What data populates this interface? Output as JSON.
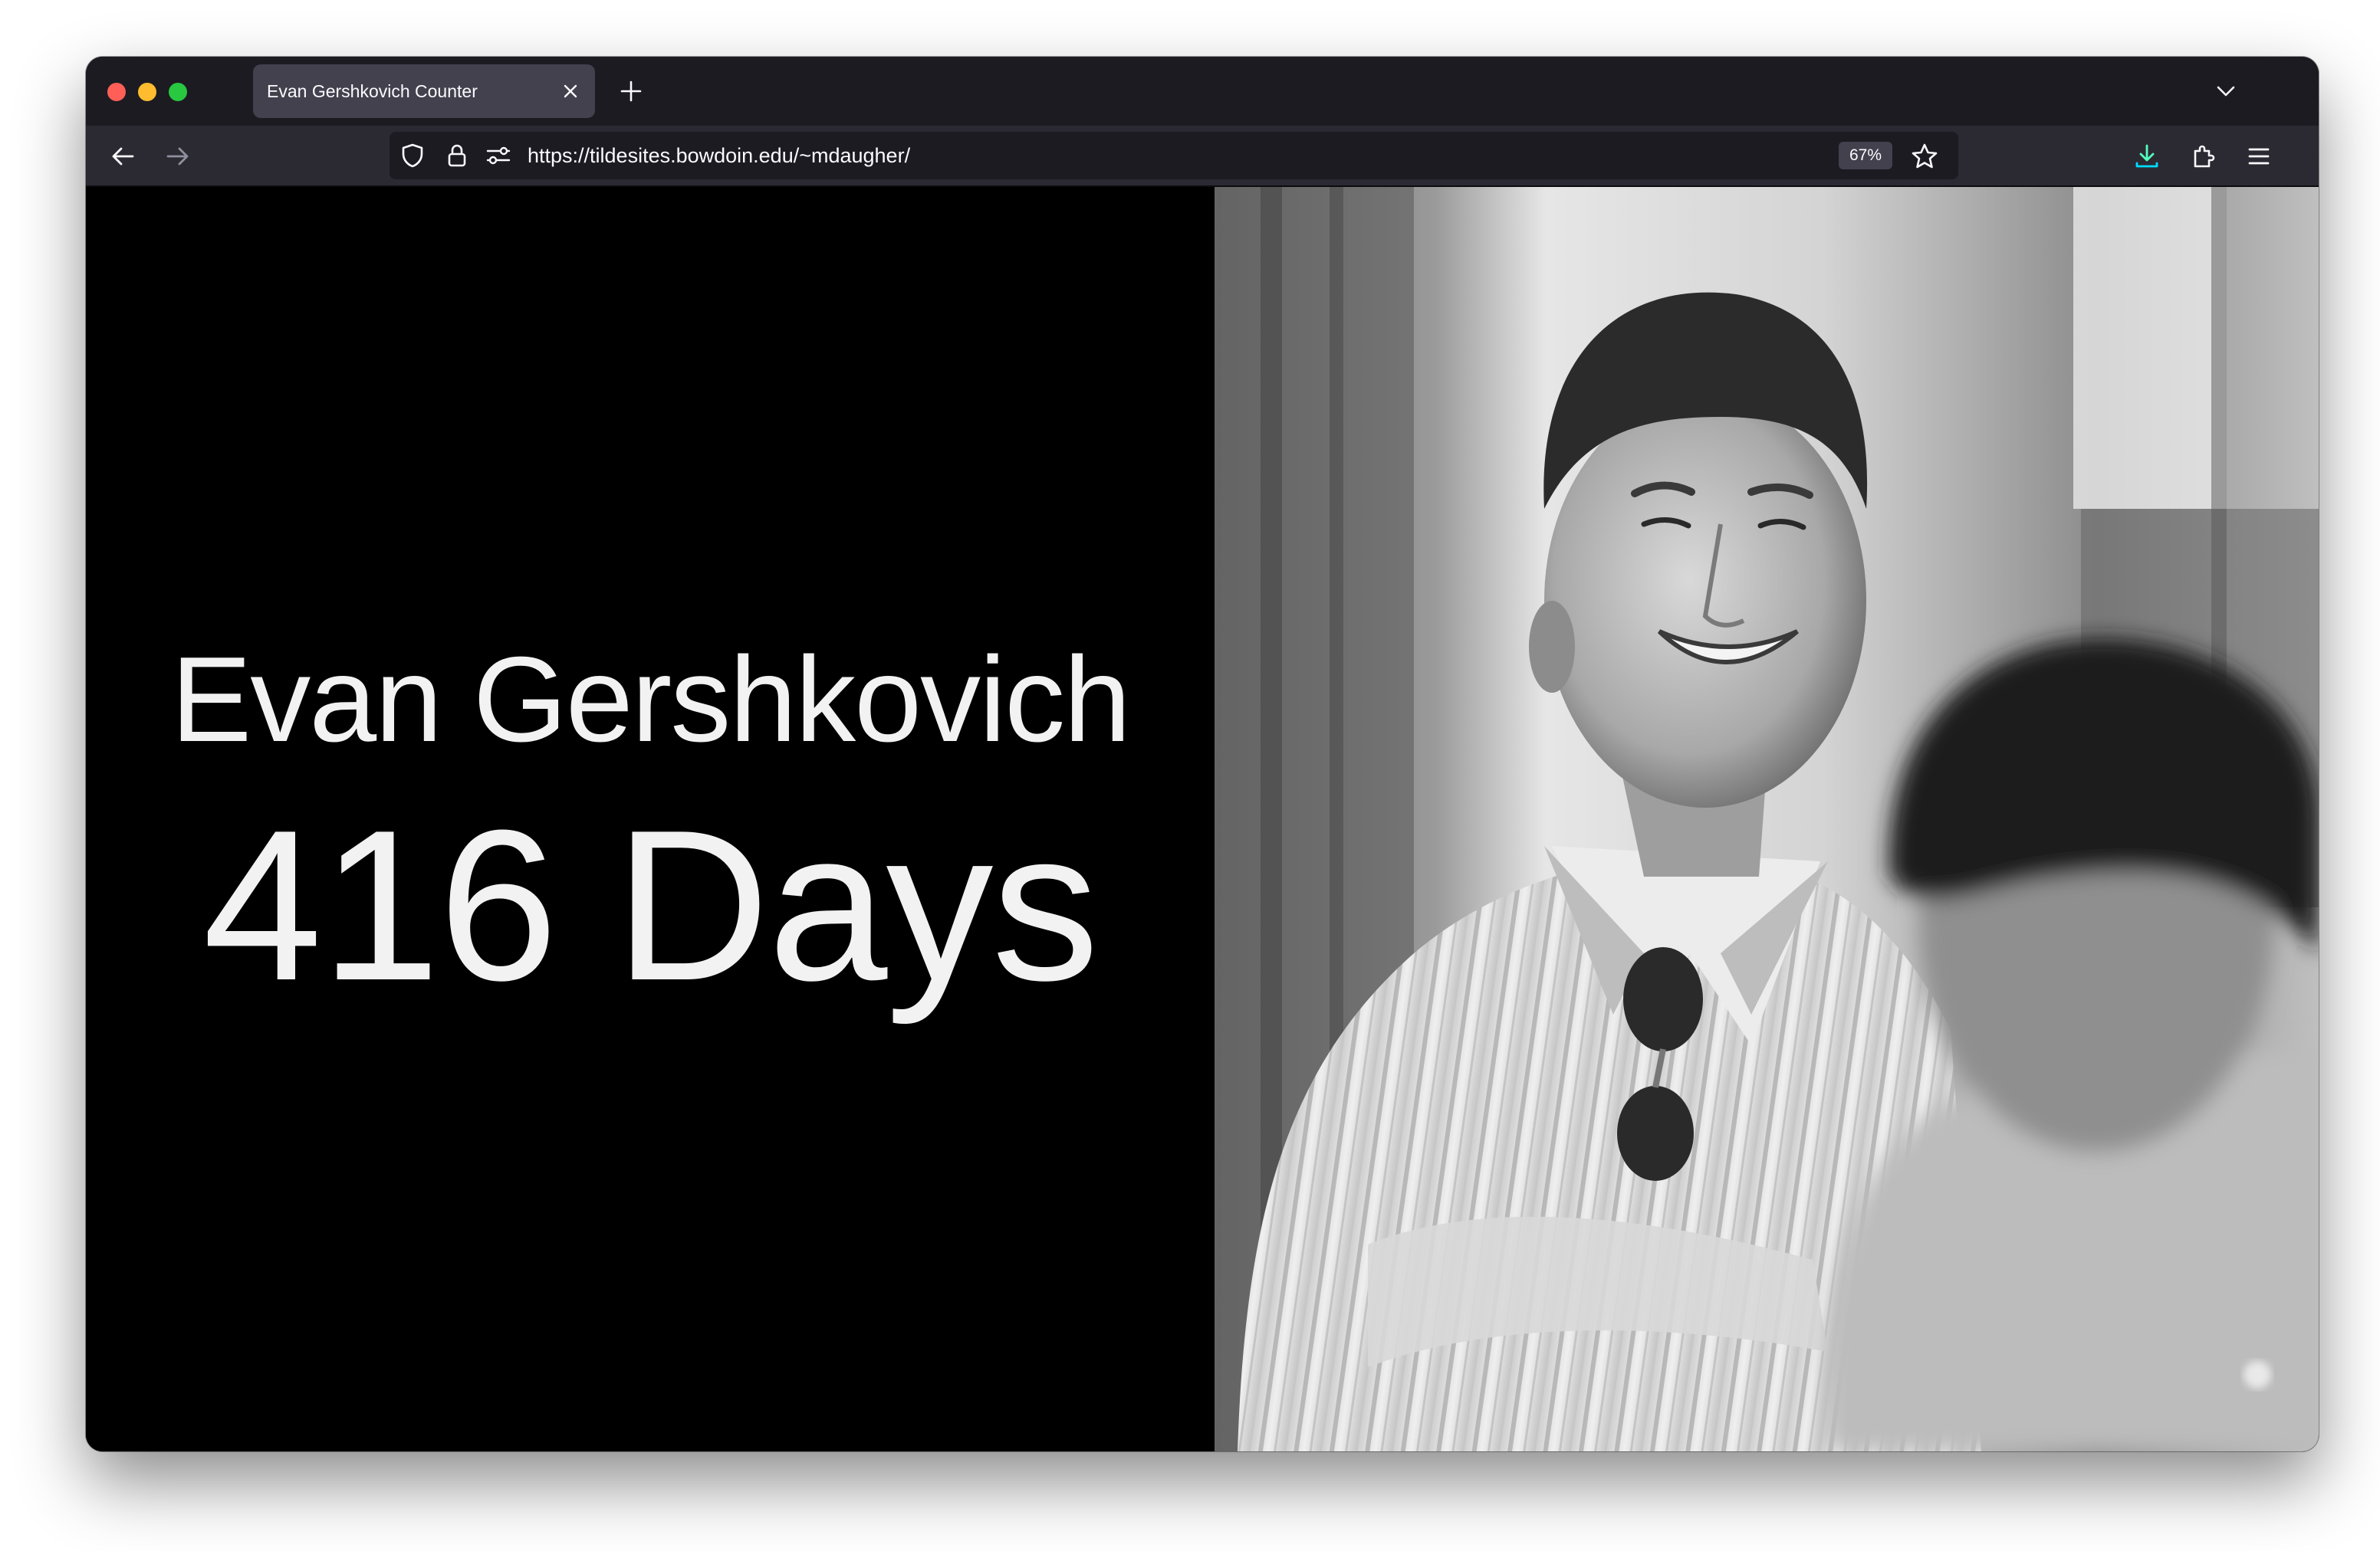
{
  "browser": {
    "tab_title": "Evan Gershkovich Counter",
    "url": "https://tildesites.bowdoin.edu/~mdaugher/",
    "zoom_level": "67%"
  },
  "page": {
    "name": "Evan Gershkovich",
    "days_count": "416 Days"
  },
  "colors": {
    "tabbar_bg": "#1c1b22",
    "navbar_bg": "#2b2a33",
    "page_bg": "#000000",
    "text": "#f2f2f2",
    "download_accent": "#54ffbd"
  },
  "icons": [
    "back-icon",
    "forward-icon",
    "shield-icon",
    "lock-icon",
    "permissions-icon",
    "star-icon",
    "download-icon",
    "extensions-icon",
    "menu-icon",
    "close-icon",
    "plus-icon",
    "chevron-down-icon"
  ]
}
